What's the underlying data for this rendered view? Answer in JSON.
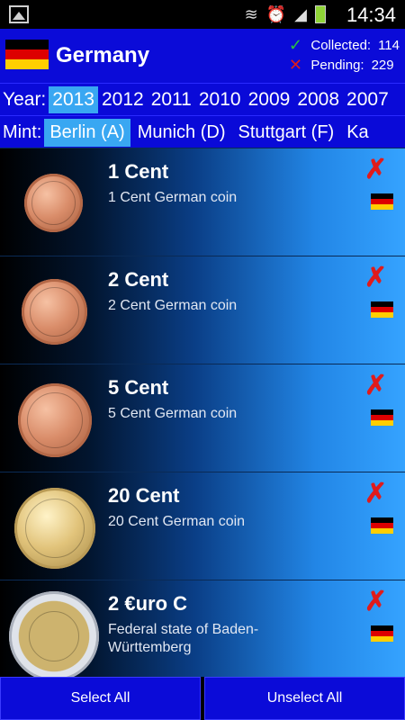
{
  "status_bar": {
    "time": "14:34",
    "icons": [
      "gallery-icon",
      "wifi-icon",
      "alarm-icon",
      "signal-icon",
      "battery-icon"
    ]
  },
  "header": {
    "country": "Germany",
    "collected_label": "Collected:",
    "collected_value": "114",
    "pending_label": "Pending:",
    "pending_value": "229"
  },
  "year_filter": {
    "label": "Year:",
    "years": [
      "2013",
      "2012",
      "2011",
      "2010",
      "2009",
      "2008",
      "2007"
    ],
    "selected": "2013"
  },
  "mint_filter": {
    "label": "Mint:",
    "mints": [
      "Berlin (A)",
      "Munich (D)",
      "Stuttgart (F)",
      "Ka"
    ],
    "selected": "Berlin (A)"
  },
  "coins": [
    {
      "title": "1 Cent",
      "description": "1 Cent German coin",
      "type": "copper"
    },
    {
      "title": "2 Cent",
      "description": "2 Cent German coin",
      "type": "copper"
    },
    {
      "title": "5 Cent",
      "description": "5 Cent German coin",
      "type": "copper"
    },
    {
      "title": "20 Cent",
      "description": "20 Cent German coin",
      "type": "gold"
    },
    {
      "title": "2 €uro C",
      "description": "Federal state of Baden-Württemberg",
      "type": "bimetal"
    }
  ],
  "actions": {
    "select_all": "Select All",
    "unselect_all": "Unselect All"
  },
  "colors": {
    "flag_black": "#000000",
    "flag_red": "#dd0000",
    "flag_gold": "#ffce00",
    "header_blue": "#0b0bd8",
    "selected_blue": "#39a7f2"
  }
}
